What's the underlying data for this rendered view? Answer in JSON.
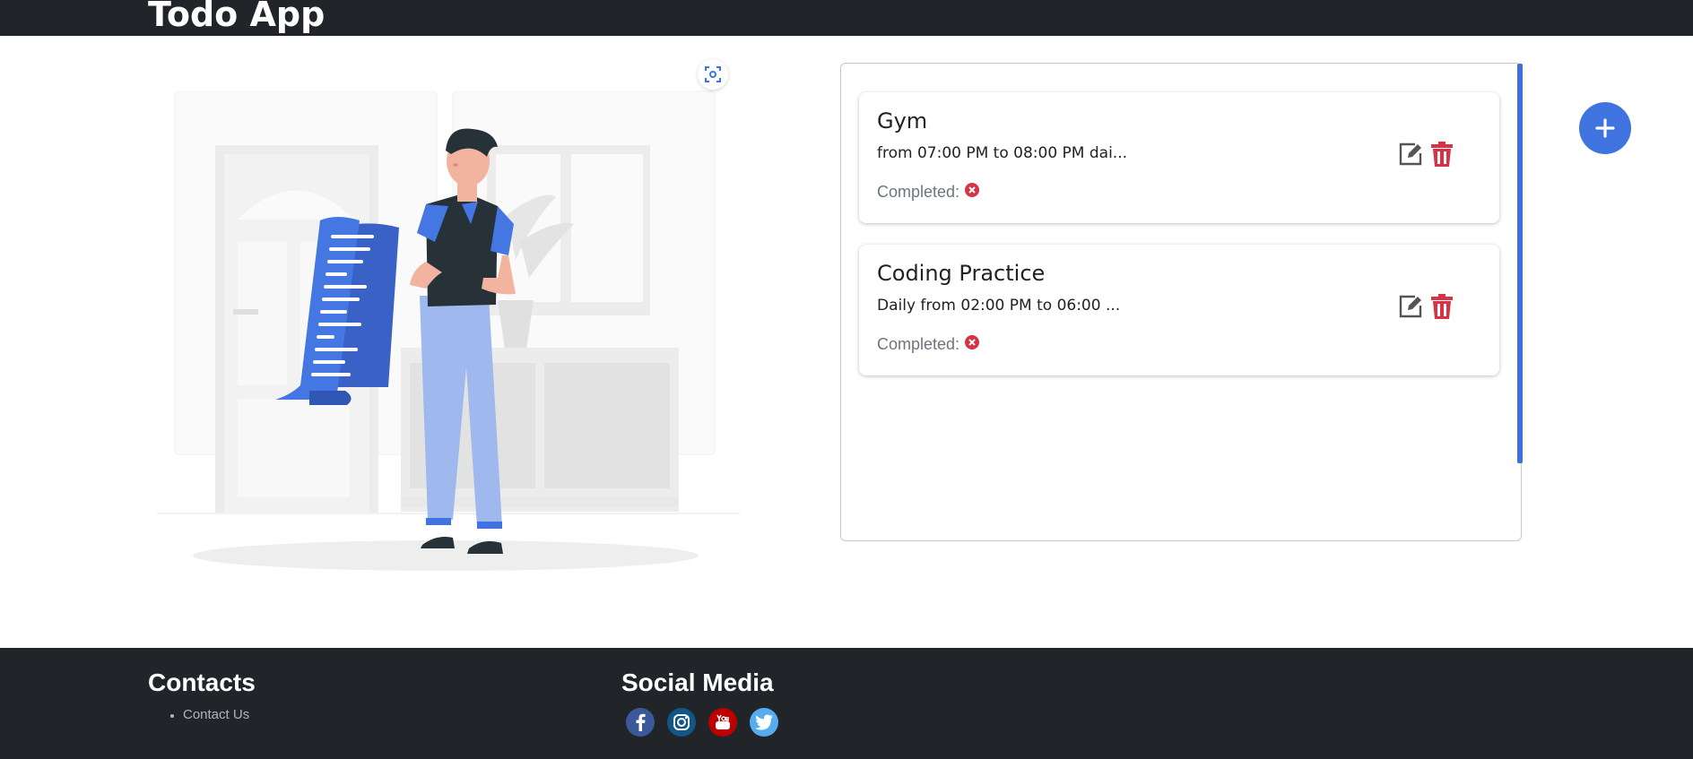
{
  "header": {
    "title": "Todo App"
  },
  "illustration": {
    "icon": "person-reading-list-illustration"
  },
  "scan_button": {
    "icon": "focus-scan-icon"
  },
  "todos": [
    {
      "title": "Gym",
      "description": "from 07:00 PM to 08:00 PM dai...",
      "status_label": "Completed:",
      "completed": false
    },
    {
      "title": "Coding Practice",
      "description": "Daily from 02:00 PM to 06:00 ...",
      "status_label": "Completed:",
      "completed": false
    }
  ],
  "add_button": {
    "icon": "plus-icon"
  },
  "footer": {
    "contacts_heading": "Contacts",
    "contact_links": [
      "Contact Us"
    ],
    "social_heading": "Social Media",
    "social": [
      {
        "name": "facebook-icon",
        "color": "#3b5998"
      },
      {
        "name": "instagram-icon",
        "color": "#125688"
      },
      {
        "name": "youtube-icon",
        "color": "#bb0000"
      },
      {
        "name": "twitter-icon",
        "color": "#55acee"
      }
    ]
  },
  "colors": {
    "accent": "#3f74e0",
    "danger": "#d63346",
    "dark": "#212529"
  }
}
